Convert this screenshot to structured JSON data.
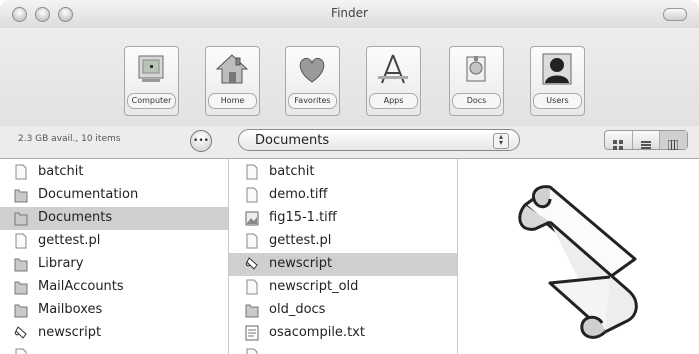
{
  "window": {
    "title": "Finder"
  },
  "toolbar": {
    "items": [
      {
        "label": "Computer",
        "icon": "computer-icon"
      },
      {
        "label": "Home",
        "icon": "home-icon"
      },
      {
        "label": "Favorites",
        "icon": "heart-icon"
      },
      {
        "label": "Apps",
        "icon": "apps-icon"
      },
      {
        "label": "Docs",
        "icon": "docs-icon"
      },
      {
        "label": "Users",
        "icon": "users-icon"
      }
    ]
  },
  "status": {
    "text": "2.3 GB avail., 10 items"
  },
  "path_popup": {
    "value": "Documents"
  },
  "column1": {
    "items": [
      {
        "name": "batchit",
        "type": "doc",
        "selected": false
      },
      {
        "name": "Documentation",
        "type": "folder",
        "selected": false
      },
      {
        "name": "Documents",
        "type": "folder",
        "selected": true
      },
      {
        "name": "gettest.pl",
        "type": "doc",
        "selected": false
      },
      {
        "name": "Library",
        "type": "folder",
        "selected": false
      },
      {
        "name": "MailAccounts",
        "type": "folder",
        "selected": false
      },
      {
        "name": "Mailboxes",
        "type": "folder",
        "selected": false
      },
      {
        "name": "newscript",
        "type": "script",
        "selected": false
      },
      {
        "name": "",
        "type": "doc",
        "selected": false
      }
    ]
  },
  "column2": {
    "items": [
      {
        "name": "batchit",
        "type": "doc",
        "selected": false
      },
      {
        "name": "demo.tiff",
        "type": "doc",
        "selected": false
      },
      {
        "name": "fig15-1.tiff",
        "type": "image",
        "selected": false
      },
      {
        "name": "gettest.pl",
        "type": "doc",
        "selected": false
      },
      {
        "name": "newscript",
        "type": "script",
        "selected": true
      },
      {
        "name": "newscript_old",
        "type": "doc",
        "selected": false
      },
      {
        "name": "old_docs",
        "type": "folder",
        "selected": false
      },
      {
        "name": "osacompile.txt",
        "type": "text",
        "selected": false
      },
      {
        "name": "",
        "type": "doc",
        "selected": false
      }
    ]
  },
  "preview": {
    "icon": "script-scroll-icon"
  }
}
